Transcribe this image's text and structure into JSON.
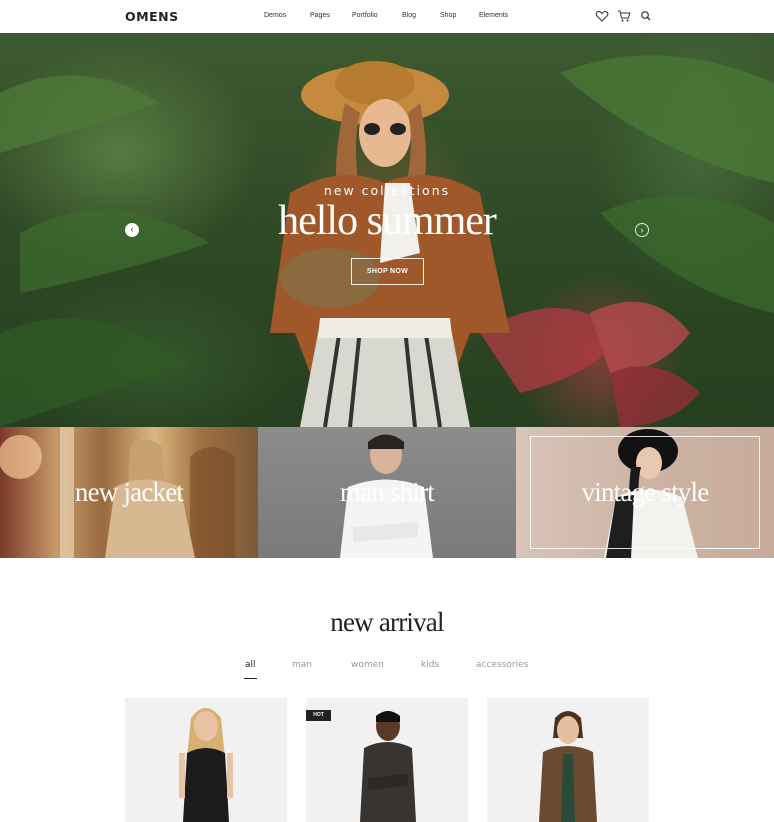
{
  "header": {
    "logo": "OMENS",
    "nav": [
      "Demos",
      "Pages",
      "Portfolio",
      "Blog",
      "Shop",
      "Elements"
    ],
    "icons": [
      "heart-icon",
      "cart-icon",
      "search-icon"
    ]
  },
  "hero": {
    "subtitle": "new collections",
    "title": "hello summer",
    "cta": "SHOP NOW",
    "prev_icon": "‹",
    "next_icon": "›"
  },
  "banners": [
    {
      "label": "new jacket"
    },
    {
      "label": "man shirt"
    },
    {
      "label": "vintage style"
    }
  ],
  "new_arrival": {
    "title": "new arrival",
    "tabs": [
      "all",
      "man",
      "women",
      "kids",
      "accessories"
    ],
    "active_tab": "all",
    "products": [
      {
        "badge": ""
      },
      {
        "badge": "HOT"
      },
      {
        "badge": ""
      }
    ]
  },
  "colors": {
    "accent": "#222222",
    "hero_green": "#2f4a26",
    "product_bg": "#f1f1f1"
  }
}
